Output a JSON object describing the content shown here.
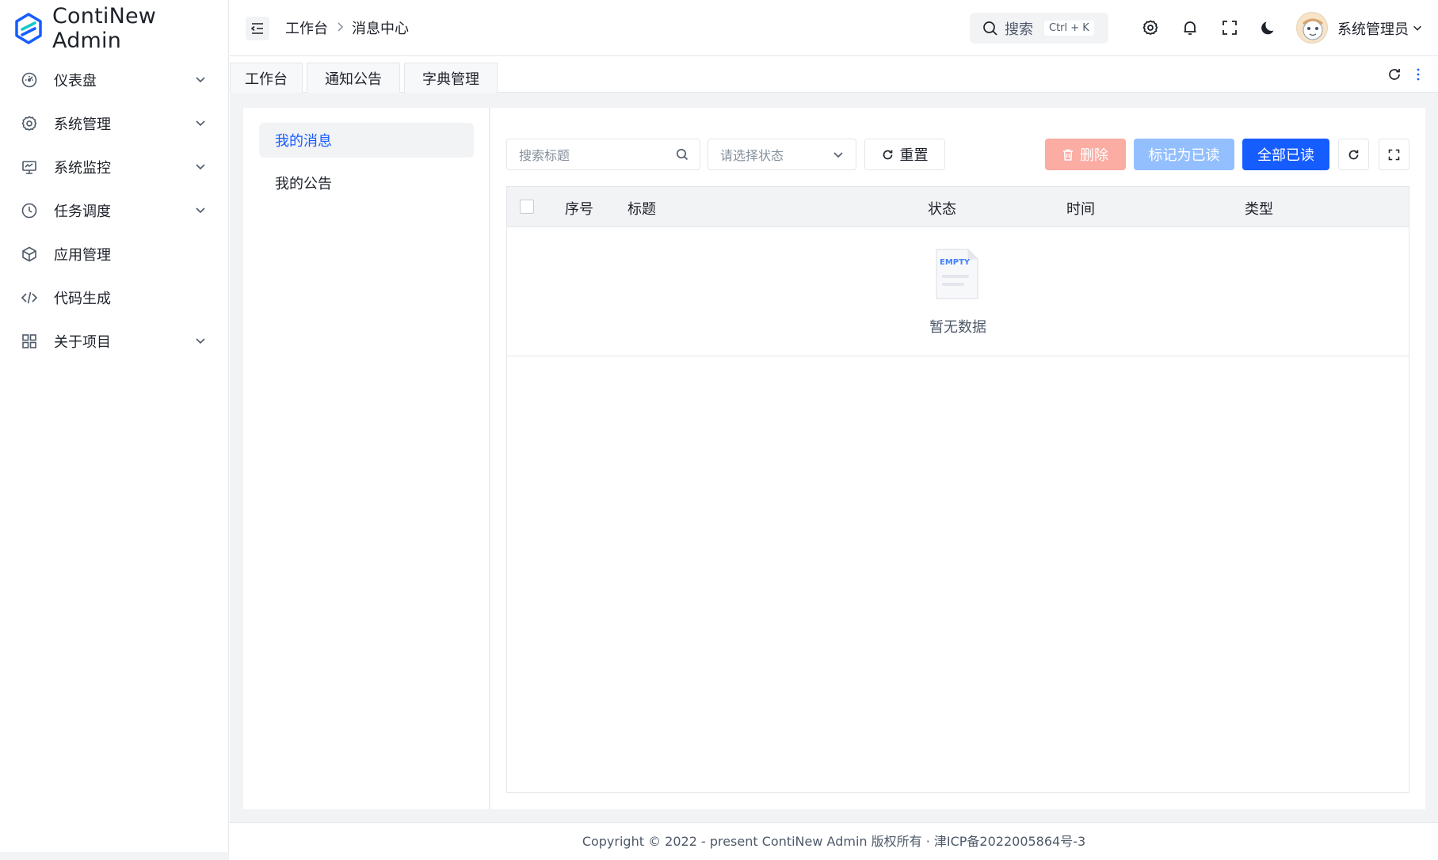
{
  "app": {
    "logo_text": "ContiNew Admin",
    "accent": "#165dff"
  },
  "sidebar": {
    "items": [
      {
        "label": "仪表盘",
        "icon": "dashboard-icon",
        "has_children": true
      },
      {
        "label": "系统管理",
        "icon": "gear-icon",
        "has_children": true
      },
      {
        "label": "系统监控",
        "icon": "monitor-icon",
        "has_children": true
      },
      {
        "label": "任务调度",
        "icon": "clock-icon",
        "has_children": true
      },
      {
        "label": "应用管理",
        "icon": "cube-icon",
        "has_children": false
      },
      {
        "label": "代码生成",
        "icon": "code-icon",
        "has_children": false
      },
      {
        "label": "关于项目",
        "icon": "apps-grid-icon",
        "has_children": true
      }
    ]
  },
  "header": {
    "breadcrumb": [
      "工作台",
      "消息中心"
    ],
    "search": {
      "placeholder": "搜索",
      "shortcut": "Ctrl + K"
    },
    "user": {
      "name": "系统管理员"
    }
  },
  "tabs": [
    {
      "label": "工作台"
    },
    {
      "label": "通知公告"
    },
    {
      "label": "字典管理"
    }
  ],
  "left_menu": {
    "items": [
      {
        "label": "我的消息",
        "active": true
      },
      {
        "label": "我的公告",
        "active": false
      }
    ]
  },
  "toolbar": {
    "search_placeholder": "搜索标题",
    "status_placeholder": "请选择状态",
    "reset_label": "重置",
    "delete_label": "删除",
    "mark_read_label": "标记为已读",
    "mark_all_read_label": "全部已读"
  },
  "table": {
    "columns": [
      "序号",
      "标题",
      "状态",
      "时间",
      "类型"
    ],
    "empty_text": "暂无数据",
    "empty_badge": "EMPTY"
  },
  "footer": {
    "text": "Copyright © 2022 - present ContiNew Admin 版权所有 · 津ICP备2022005864号-3"
  }
}
